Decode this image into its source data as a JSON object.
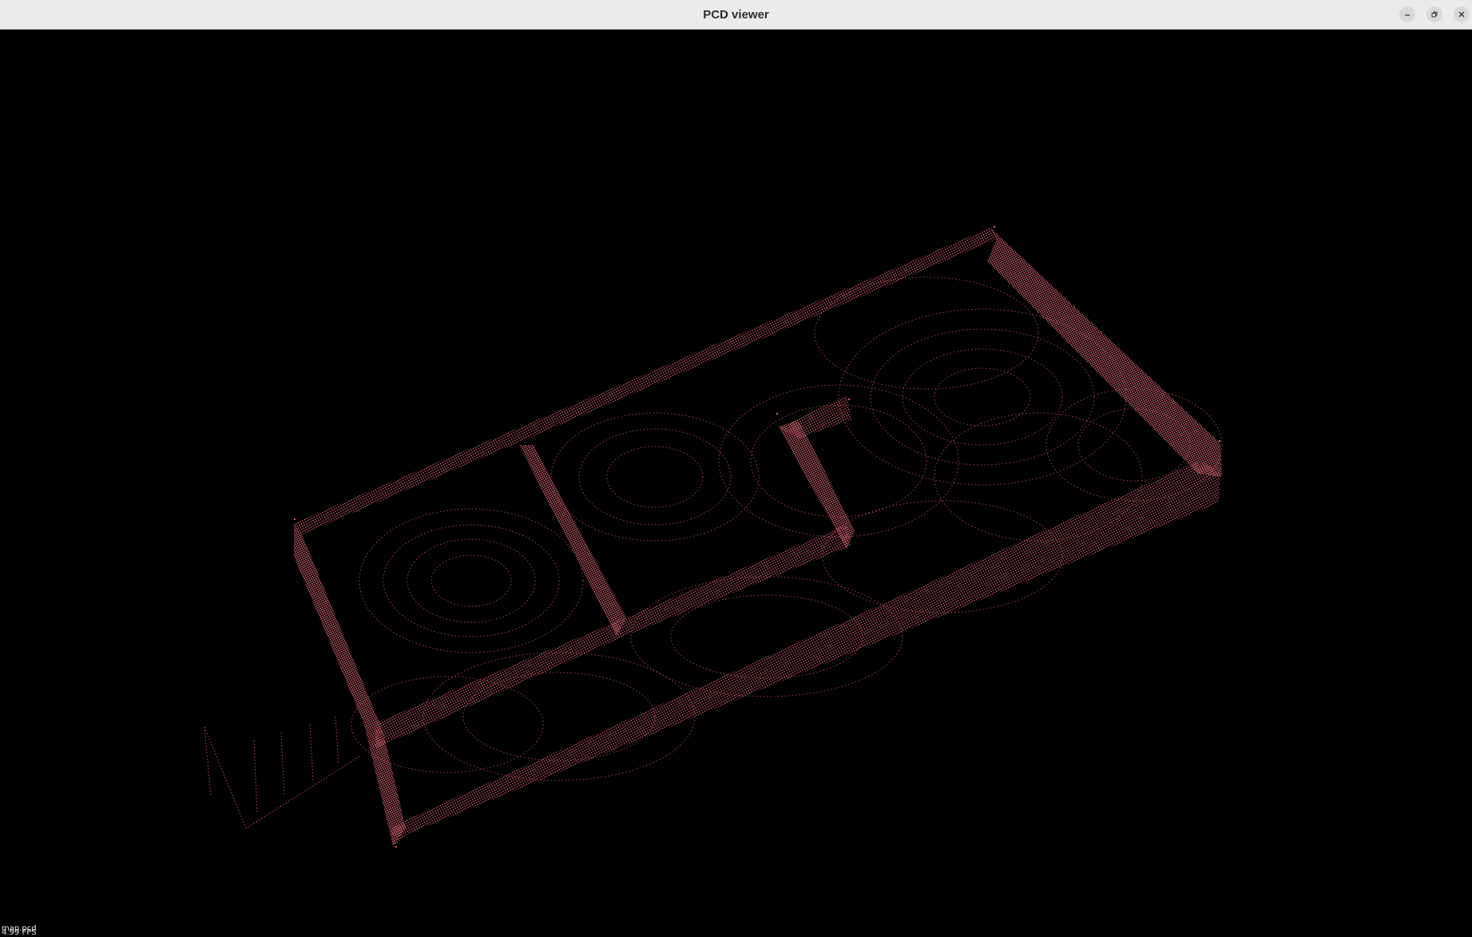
{
  "window": {
    "title": "PCD viewer"
  },
  "icons": {
    "minimize": "minimize-icon",
    "maximize": "maximize-icon",
    "close": "close-icon"
  },
  "colors": {
    "titlebar_bg": "#ebebeb",
    "viewport_bg": "#000000",
    "points": "#d9606e"
  },
  "overlay": {
    "fps_text": "4.99 FPS",
    "file_text": "map.pcd"
  }
}
